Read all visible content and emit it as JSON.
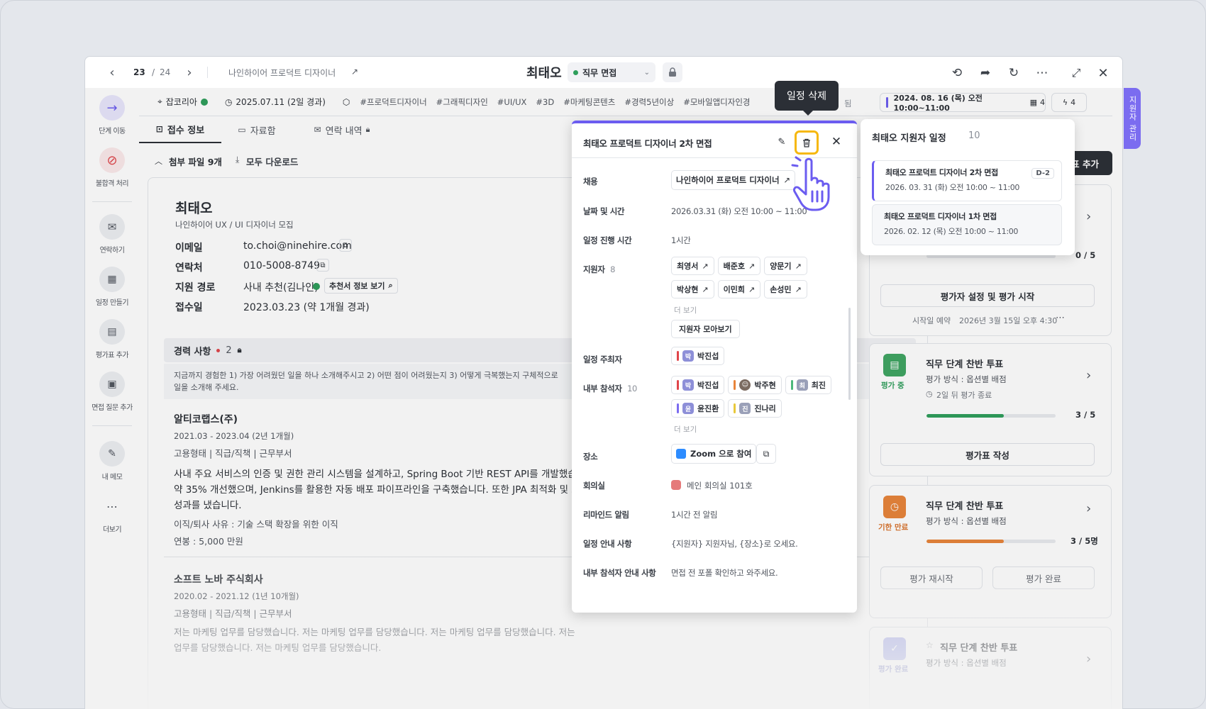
{
  "header": {
    "page_current": "23",
    "page_sep": "/",
    "page_total": "24",
    "job_link": "나인하이어 프로덕트 디자이너",
    "candidate": "최태오",
    "stage": "직무 면접"
  },
  "infobar": {
    "company": "잡코리아",
    "date": "2025.07.11 (2일 경과)",
    "tags": [
      "#프로덕트디자이너",
      "#그래픽디자인",
      "#UI/UX",
      "#3D",
      "#마케팅콘텐츠",
      "#경력5년이상",
      "#모바일앱디자인경"
    ],
    "tag_more": "됨",
    "schedule_chip": "2024. 08. 16 (목) 오전 10:00~11:00",
    "schedule_count": "4",
    "flash_count": "4"
  },
  "side_tab": "지원자 관리",
  "sidebar": [
    {
      "label": "단계 이동",
      "icon": "arrow-right-icon"
    },
    {
      "label": "불합격 처리",
      "icon": "ban-icon"
    },
    {
      "label": "연락하기",
      "icon": "mail-icon"
    },
    {
      "label": "일정 만들기",
      "icon": "calendar-icon"
    },
    {
      "label": "평가표 추가",
      "icon": "clipboard-icon"
    },
    {
      "label": "면접 질문 추가",
      "icon": "question-icon"
    },
    {
      "label": "내 메모",
      "icon": "memo-icon"
    },
    {
      "label": "더보기",
      "icon": "more-icon"
    }
  ],
  "tabs": [
    {
      "label": "접수 정보"
    },
    {
      "label": "자료함"
    },
    {
      "label": "연락 내역"
    }
  ],
  "attach": {
    "label": "첨부 파일 9개",
    "download": "모두 다운로드"
  },
  "profile": {
    "name": "최태오",
    "subtitle": "나인하이어 UX / UI 디자이너 모집",
    "email_label": "이메일",
    "email": "to.choi@ninehire.com",
    "phone_label": "연락처",
    "phone": "010-5008-8749",
    "route_label": "지원 경로",
    "route": "사내 추천(김나인)",
    "route_btn": "추천서 정보 보기",
    "date_label": "접수일",
    "date": "2023.03.23 (약 1개월 경과)"
  },
  "career": {
    "title": "경력 사항",
    "count": "2",
    "question": "지금까지 경험한 1) 가장 어려웠던 일을 하나 소개해주시고 2) 어떤 점이 어려웠는지 3) 어떻게 극복했는지 구체적으로",
    "question2": "일을 소개해 주세요.",
    "companies": [
      {
        "name": "알티코랩스(주)",
        "period": "2021.03 - 2023.04 (2년 1개월)",
        "meta": "고용형태 | 직급/직책 | 근무부서",
        "desc1": "사내 주요 서비스의 인증 및 권한 관리 시스템을 설계하고, Spring Boot 기반 REST API를 개발했습니",
        "desc2": "약 35% 개선했으며, Jenkins를 활용한 자동 배포 파이프라인을 구축했습니다. 또한 JPA 최적화 및 로",
        "desc3": "성과를 냈습니다.",
        "reason": "이직/퇴사 사유 : 기술 스택 확장을 위한 이직",
        "salary": "연봉 : 5,000 만원"
      },
      {
        "name": "소프트 노바 주식회사",
        "period": "2020.02 - 2021.12 (1년 10개월)",
        "meta": "고용형태 | 직급/직책 | 근무부서",
        "desc1": "저는 마케팅 업무를 담당했습니다. 저는 마케팅 업무를 담당했습니다. 저는 마케팅 업무를 담당했습니다. 저는",
        "desc2": "업무를 담당했습니다. 저는 마케팅 업무를 담당했습니다."
      }
    ]
  },
  "eval": {
    "add_btn": "표 추가",
    "count1": "0 / 5",
    "setup_btn": "평가자 설정 및 평가 시작",
    "start_label": "시작일 예약",
    "start_date": "2026년 3월 15일 오후 4:30",
    "cards": [
      {
        "status": "평가 중",
        "title": "직무 단계 찬반 투표",
        "method": "평가 방식 : 옵션별 배점",
        "remain": "2일 뒤 평가 종료",
        "progress": "3 / 5",
        "pct": 0.6,
        "btn": "평가표 작성"
      },
      {
        "status": "기한 만료",
        "title": "직무 단계 찬반 투표",
        "method": "평가 방식 : 옵션별 배점",
        "progress": "3 / 5명",
        "pct": 0.6,
        "btn1": "평가 재시작",
        "btn2": "평가 완료"
      },
      {
        "status": "평가 완료",
        "title": "직무 단계 찬반 투표",
        "method": "평가 방식 : 옵션별 배점"
      }
    ]
  },
  "popover": {
    "title": "최태오 프로덕트 디자이너 2차 면접",
    "tooltip": "일정 삭제",
    "job_label": "채용",
    "job": "나인하이어 프로덕트 디자이너",
    "datetime_label": "날짜 및 시간",
    "datetime": "2026.03.31 (화) 오전 10:00 ~ 11:00",
    "duration_label": "일정 진행 시간",
    "duration": "1시간",
    "applicants_label": "지원자",
    "applicants_count": "8",
    "applicants": [
      "최영서",
      "배준호",
      "양문기",
      "박상현",
      "이민희",
      "손성민"
    ],
    "more": "더 보기",
    "collect_btn": "지원자 모아보기",
    "host_label": "일정 주최자",
    "host": "박진섭",
    "host_av": "박",
    "internal_label": "내부 참석자",
    "internal_count": "10",
    "internal": [
      {
        "name": "박진섭",
        "av": "박",
        "bar": "#e0454a",
        "avc": "#8d8fd8"
      },
      {
        "name": "박주현",
        "av": "",
        "bar": "#e8843a",
        "avc": "#7a6a60"
      },
      {
        "name": "최진",
        "av": "최",
        "bar": "#4cb87a",
        "avc": "#9aa0b8"
      },
      {
        "name": "윤진환",
        "av": "윤",
        "bar": "#7b6cf0",
        "avc": "#8d8fd8"
      },
      {
        "name": "진나리",
        "av": "진",
        "bar": "#e8c83a",
        "avc": "#9aa0b8"
      }
    ],
    "place_label": "장소",
    "place": "Zoom 으로 참여",
    "room_label": "회의실",
    "room": "메인 회의실 101호",
    "remind_label": "리마인드 알림",
    "remind": "1시간 전 알림",
    "guide_label": "일정 안내 사항",
    "guide": "{지원자} 지원자님, {장소}로 오세요.",
    "inner_guide_label": "내부 참석자 안내 사항",
    "inner_guide": "면접 전 포폴 확인하고 와주세요."
  },
  "schedules": {
    "title": "최태오 지원자 일정",
    "count": "10",
    "items": [
      {
        "title": "최태오 프로덕트 디자이너 2차 면접",
        "date": "2026. 03. 31 (화) 오전 10:00 ~ 11:00",
        "badge": "D-2"
      },
      {
        "title": "최태오 프로덕트 디자이너 1차 면접",
        "date": "2026. 02. 12 (목) 오전 10:00 ~ 11:00"
      }
    ]
  },
  "colors": {
    "accent": "#6b5cf0",
    "highlight": "#f6b80f",
    "green": "#2e9e5b",
    "orange": "#e8843a"
  }
}
